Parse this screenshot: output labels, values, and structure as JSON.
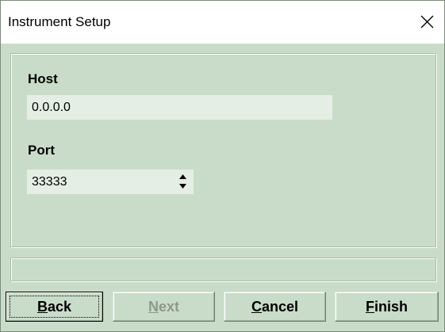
{
  "window": {
    "title": "Instrument Setup"
  },
  "icons": {
    "close": "close-icon",
    "spin_up": "spin-up-arrow-icon",
    "spin_down": "spin-down-arrow-icon"
  },
  "form": {
    "host_label": "Host",
    "host_value": "0.0.0.0",
    "port_label": "Port",
    "port_value": "33333"
  },
  "status": {
    "text": ""
  },
  "buttons": {
    "back": "Back",
    "next": "Next",
    "cancel": "Cancel",
    "finish": "Finish"
  },
  "colors": {
    "dialog_background": "#c9dcc9",
    "input_background": "#e4eee4",
    "disabled_text": "#8c9a8c"
  }
}
